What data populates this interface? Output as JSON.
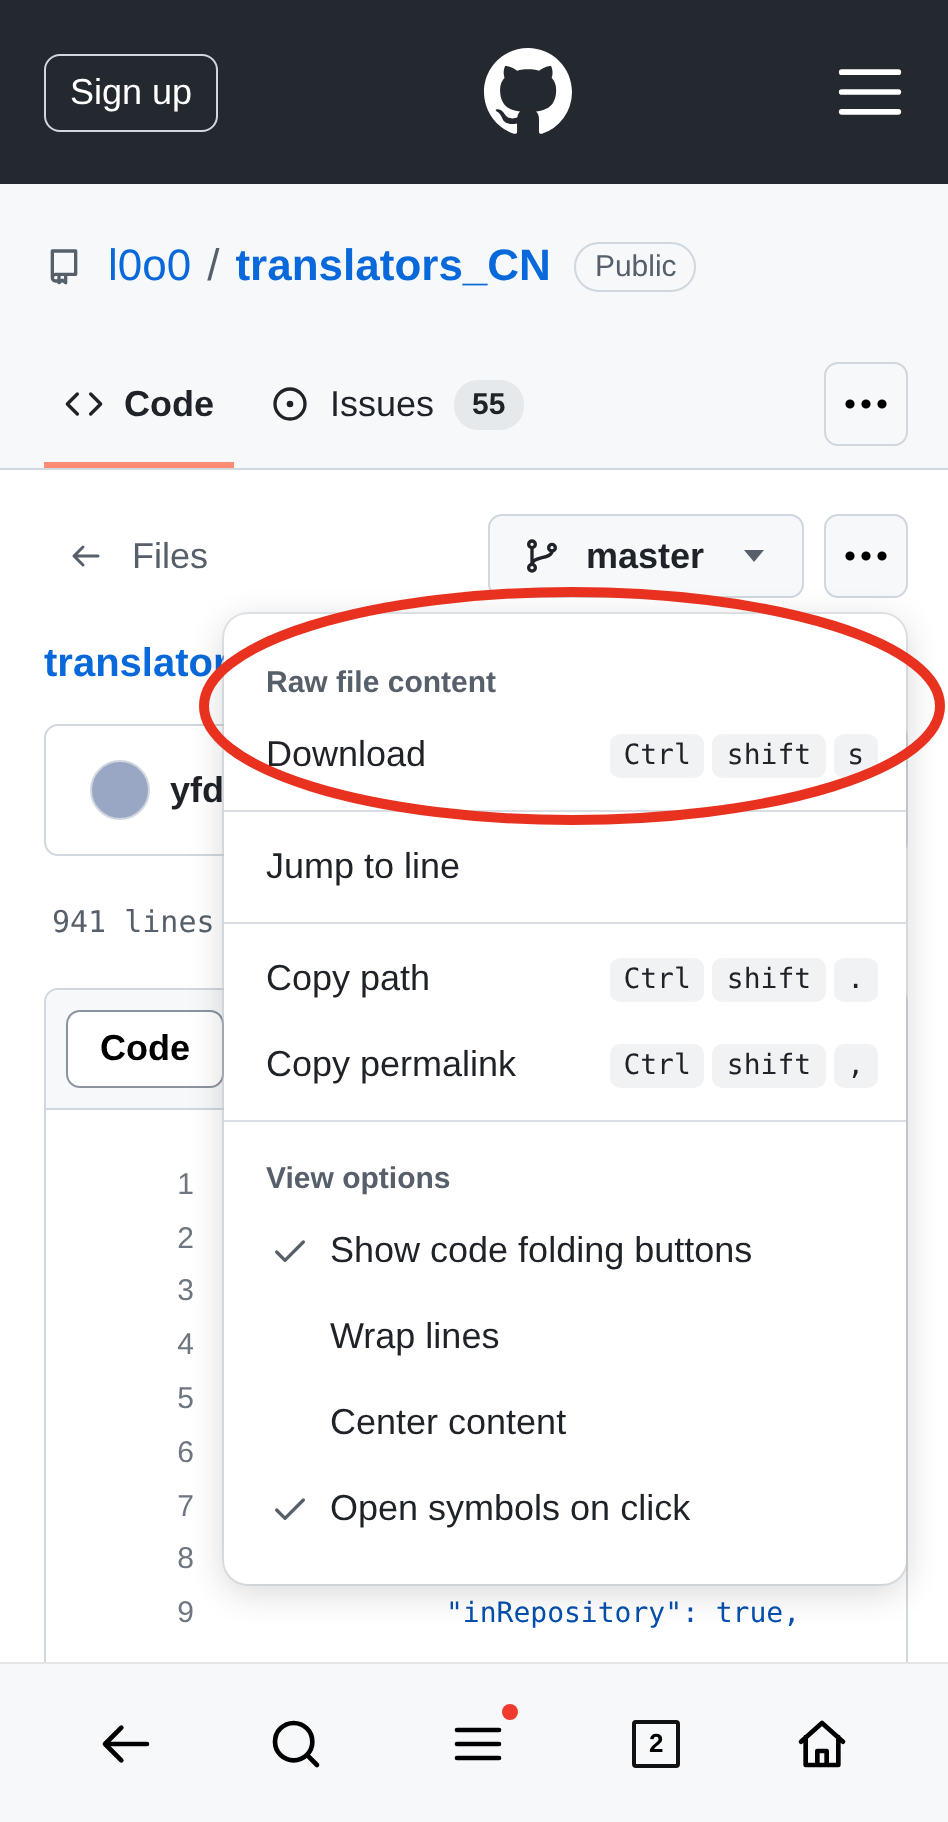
{
  "header": {
    "sign_up": "Sign up"
  },
  "repo": {
    "owner": "l0o0",
    "separator": "/",
    "name": "translators_CN",
    "visibility": "Public"
  },
  "tabs": [
    {
      "label": "Code",
      "kind": "code",
      "selected": true
    },
    {
      "label": "Issues",
      "kind": "issues",
      "count": "55",
      "selected": false
    }
  ],
  "file_nav": {
    "back_label": "Files",
    "branch": "master"
  },
  "file_name": "translator",
  "commit": {
    "author": "yfd"
  },
  "line_info": "941 lines",
  "code_view": {
    "button": "Code",
    "lines": [
      {
        "number": "1"
      },
      {
        "number": "2"
      },
      {
        "number": "3"
      },
      {
        "number": "4"
      },
      {
        "number": "5"
      },
      {
        "number": "6"
      },
      {
        "number": "7"
      },
      {
        "number": "8"
      },
      {
        "number": "9",
        "text": "\"inRepository\": true,"
      }
    ]
  },
  "menu": {
    "sections": [
      {
        "title": "Raw file content",
        "items": [
          {
            "kind": "shortcut",
            "label": "Download",
            "keys": [
              "Ctrl",
              "shift",
              "s"
            ]
          }
        ]
      },
      {
        "items": [
          {
            "kind": "shortcut",
            "label": "Jump to line"
          }
        ]
      },
      {
        "items": [
          {
            "kind": "shortcut",
            "label": "Copy path",
            "keys": [
              "Ctrl",
              "shift",
              "."
            ]
          },
          {
            "kind": "shortcut",
            "label": "Copy permalink",
            "keys": [
              "Ctrl",
              "shift",
              ","
            ]
          }
        ]
      },
      {
        "title": "View options",
        "items": [
          {
            "kind": "toggle",
            "label": "Show code folding buttons",
            "checked": true
          },
          {
            "kind": "toggle",
            "label": "Wrap lines",
            "checked": false
          },
          {
            "kind": "toggle",
            "label": "Center content",
            "checked": false
          },
          {
            "kind": "toggle",
            "label": "Open symbols on click",
            "checked": true
          }
        ]
      }
    ]
  },
  "bottom_nav": {
    "tab_count": "2",
    "menu_notification": true
  }
}
